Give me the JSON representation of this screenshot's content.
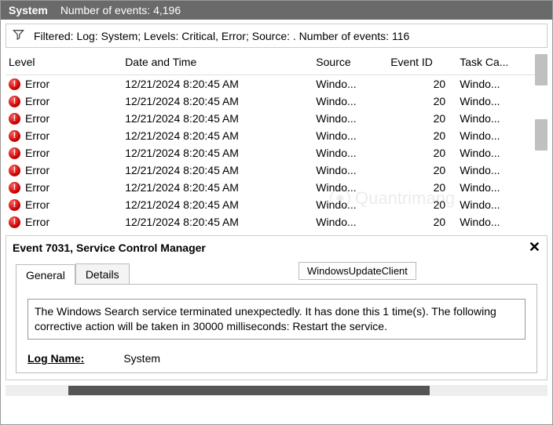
{
  "topbar": {
    "title": "System",
    "events_text": "Number of events: 4,196"
  },
  "filter": {
    "text": "Filtered: Log: System; Levels: Critical, Error; Source: . Number of events: 116"
  },
  "columns": {
    "level": "Level",
    "date": "Date and Time",
    "source": "Source",
    "eventid": "Event ID",
    "task": "Task Ca..."
  },
  "rows": [
    {
      "level": "Error",
      "date": "12/21/2024 8:20:45 AM",
      "source": "Windo...",
      "eventid": "20",
      "task": "Windo..."
    },
    {
      "level": "Error",
      "date": "12/21/2024 8:20:45 AM",
      "source": "Windo...",
      "eventid": "20",
      "task": "Windo..."
    },
    {
      "level": "Error",
      "date": "12/21/2024 8:20:45 AM",
      "source": "Windo...",
      "eventid": "20",
      "task": "Windo..."
    },
    {
      "level": "Error",
      "date": "12/21/2024 8:20:45 AM",
      "source": "Windo...",
      "eventid": "20",
      "task": "Windo..."
    },
    {
      "level": "Error",
      "date": "12/21/2024 8:20:45 AM",
      "source": "Windo...",
      "eventid": "20",
      "task": "Windo..."
    },
    {
      "level": "Error",
      "date": "12/21/2024 8:20:45 AM",
      "source": "Windo...",
      "eventid": "20",
      "task": "Windo..."
    },
    {
      "level": "Error",
      "date": "12/21/2024 8:20:45 AM",
      "source": "Windo...",
      "eventid": "20",
      "task": "Windo..."
    },
    {
      "level": "Error",
      "date": "12/21/2024 8:20:45 AM",
      "source": "Windo...",
      "eventid": "20",
      "task": "Windo..."
    },
    {
      "level": "Error",
      "date": "12/21/2024 8:20:45 AM",
      "source": "Windo...",
      "eventid": "20",
      "task": "Windo..."
    }
  ],
  "details": {
    "title": "Event 7031, Service Control Manager",
    "tooltip": "WindowsUpdateClient",
    "tabs": {
      "general": "General",
      "details": "Details"
    },
    "message": "The Windows Search service terminated unexpectedly.  It has done this 1 time(s).  The following corrective action will be taken in 30000 milliseconds: Restart the service.",
    "log_name_label": "Log Name:",
    "log_name_value": "System"
  },
  "watermark": "Quantrimang"
}
